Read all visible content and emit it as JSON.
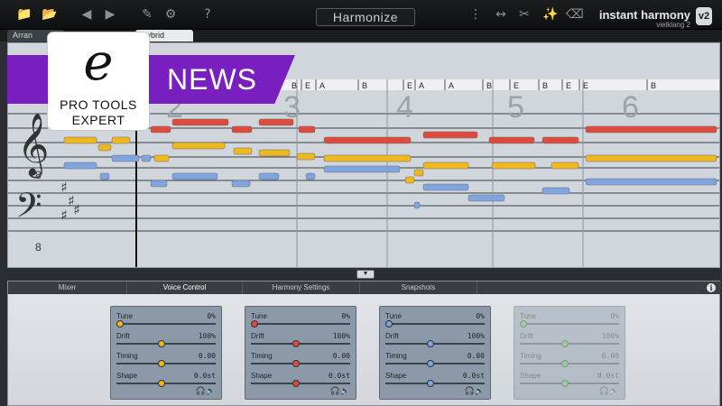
{
  "toolbar": {
    "center_title": "Harmonize",
    "app_title": "instant harmony",
    "app_subtitle": "vielklang 2",
    "app_badge": "v2",
    "icons": [
      "folder-open-icon",
      "folder-save-icon",
      "back-arrow-icon",
      "forward-arrow-icon",
      "edit-icon",
      "gear-icon",
      "help-icon",
      "dots-icon",
      "split-icon",
      "scissors-icon",
      "magic-wand-icon",
      "eraser-icon"
    ]
  },
  "view_tabs": [
    "Arran",
    "Hybrid"
  ],
  "chord_labels": [
    "B",
    "E",
    "A",
    "B",
    "E",
    "A",
    "A",
    "B",
    "E",
    "B",
    "E",
    "E",
    "B"
  ],
  "bar_numbers": [
    "2",
    "3",
    "4",
    "5",
    "6"
  ],
  "staff_labels": {
    "octave_low": "8"
  },
  "logo": {
    "letter": "e",
    "line1": "PRO TOOLS",
    "line2": "EXPERT"
  },
  "news": "NEWS",
  "bottom_tabs": [
    "Mixer",
    "Voice Control",
    "Harmony Settings",
    "Snapshots"
  ],
  "active_bottom_tab": "Voice Control",
  "voice_params": [
    "Tune",
    "Drift",
    "Timing",
    "Shape"
  ],
  "voices": [
    {
      "color": "#f0b81f",
      "values": [
        "0%",
        "100%",
        "0.00",
        "0.0st"
      ],
      "knobs": [
        0,
        0.45,
        0.45,
        0.45
      ]
    },
    {
      "color": "#e04a3c",
      "values": [
        "0%",
        "100%",
        "0.00",
        "0.0st"
      ],
      "knobs": [
        0,
        0.45,
        0.45,
        0.45
      ]
    },
    {
      "color": "#7fa4e0",
      "values": [
        "0%",
        "100%",
        "0.00",
        "0.0st"
      ],
      "knobs": [
        0,
        0.45,
        0.45,
        0.45
      ]
    },
    {
      "color": "#3cc24a",
      "values": [
        "0%",
        "100%",
        "0.00",
        "0.0st"
      ],
      "knobs": [
        0,
        0.45,
        0.45,
        0.45
      ]
    }
  ],
  "colors": {
    "voice1": "#f0b81f",
    "voice2": "#e04a3c",
    "voice3": "#7fa4e0",
    "voice4": "#3cc24a",
    "news_purple": "#7a1fbf"
  }
}
